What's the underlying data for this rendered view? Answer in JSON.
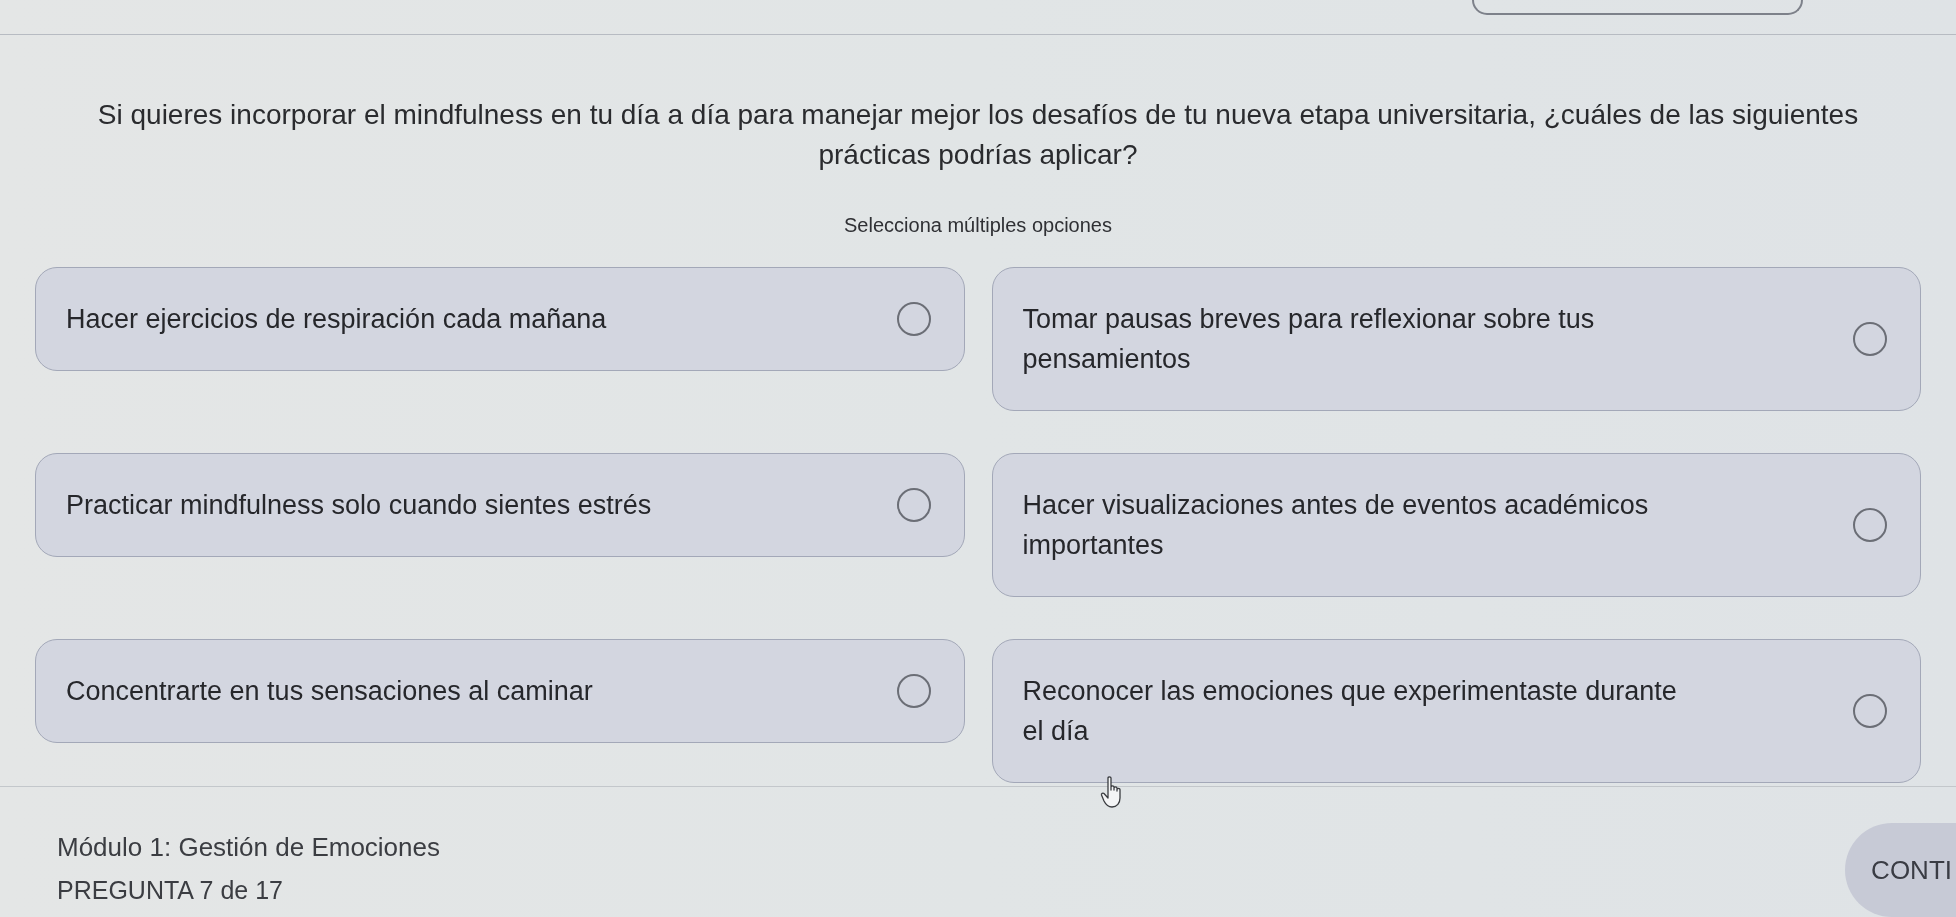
{
  "question": {
    "text": "Si quieres incorporar el mindfulness en tu día a día para manejar mejor los desafíos de tu nueva etapa universitaria, ¿cuáles de las siguientes prácticas podrías aplicar?",
    "instruction": "Selecciona múltiples opciones"
  },
  "options": [
    {
      "label": "Hacer ejercicios de respiración cada mañana",
      "checked": false
    },
    {
      "label": "Tomar pausas breves para reflexionar sobre tus pensamientos",
      "checked": false
    },
    {
      "label": "Practicar mindfulness solo cuando sientes estrés",
      "checked": false
    },
    {
      "label": "Hacer visualizaciones antes de eventos académicos importantes",
      "checked": false
    },
    {
      "label": "Concentrarte en tus sensaciones al caminar",
      "checked": false
    },
    {
      "label": "Reconocer las emociones que experimentaste durante el día",
      "checked": false
    }
  ],
  "footer": {
    "module": "Módulo 1: Gestión de Emociones",
    "progress": "PREGUNTA 7 de 17",
    "button": "CONTI"
  }
}
